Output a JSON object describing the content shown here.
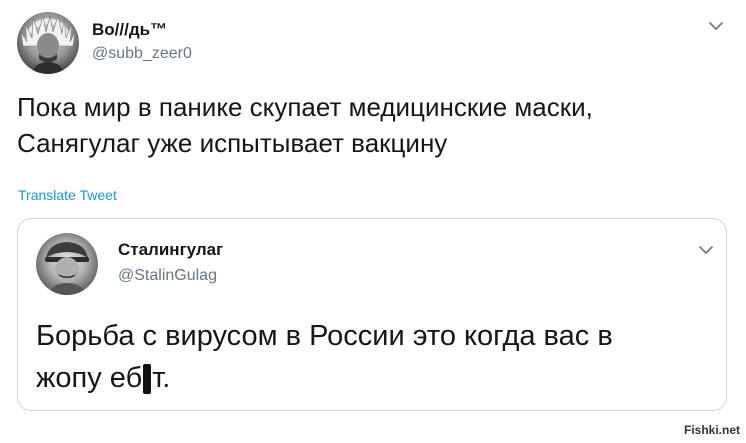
{
  "author": {
    "name": "Во///дь™",
    "handle": "@subb_zeer0"
  },
  "tweet": {
    "text_lines": [
      "Пока мир в панике скупает медицинские маски,",
      "Санягулаг уже испытывает вакцину"
    ],
    "translate_label": "Translate Tweet"
  },
  "quoted": {
    "name": "Сталингулаг",
    "handle": "@StalinGulag",
    "text_line1": "Борьба с вирусом в России это когда вас в",
    "text_line2_before": "жопу еб",
    "text_line2_after": "т."
  },
  "watermark": "Fishki.net",
  "icons": {
    "more": "chevron-down-icon"
  },
  "colors": {
    "link": "#1b95e0",
    "secondary_text": "#657786",
    "border": "#ccd6dd"
  }
}
